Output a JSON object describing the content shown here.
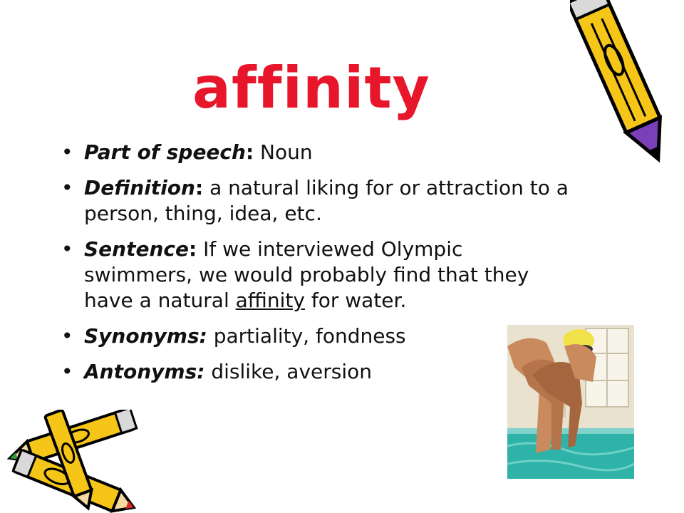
{
  "title": "affinity",
  "bullets": [
    {
      "term": "Part of speech",
      "sep": ":",
      "text": "  Noun"
    },
    {
      "term": "Definition",
      "sep": ":",
      "text": "  a natural liking for or attraction to a person, thing, idea, etc."
    },
    {
      "term": "Sentence",
      "sep": ":",
      "text_before": "  If we interviewed Olympic swimmers, we would probably find that they have a natural ",
      "underlined": "affinity",
      "text_after": " for water."
    },
    {
      "term": "Synonyms:",
      "sep": "",
      "text": "  partiality, fondness"
    },
    {
      "term": "Antonyms:",
      "sep": "",
      "text": "  dislike, aversion"
    }
  ],
  "colors": {
    "title": "#e8162b",
    "pencil_body": "#f5c518",
    "pencil_outline": "#000000",
    "pencil_eraser": "#7b3fb8",
    "pool_water": "#2fb3a8"
  },
  "images": {
    "top_right": "pencil-icon",
    "bottom_left": "crossed-pencils-icon",
    "bottom_right": "swimmers-photo"
  }
}
